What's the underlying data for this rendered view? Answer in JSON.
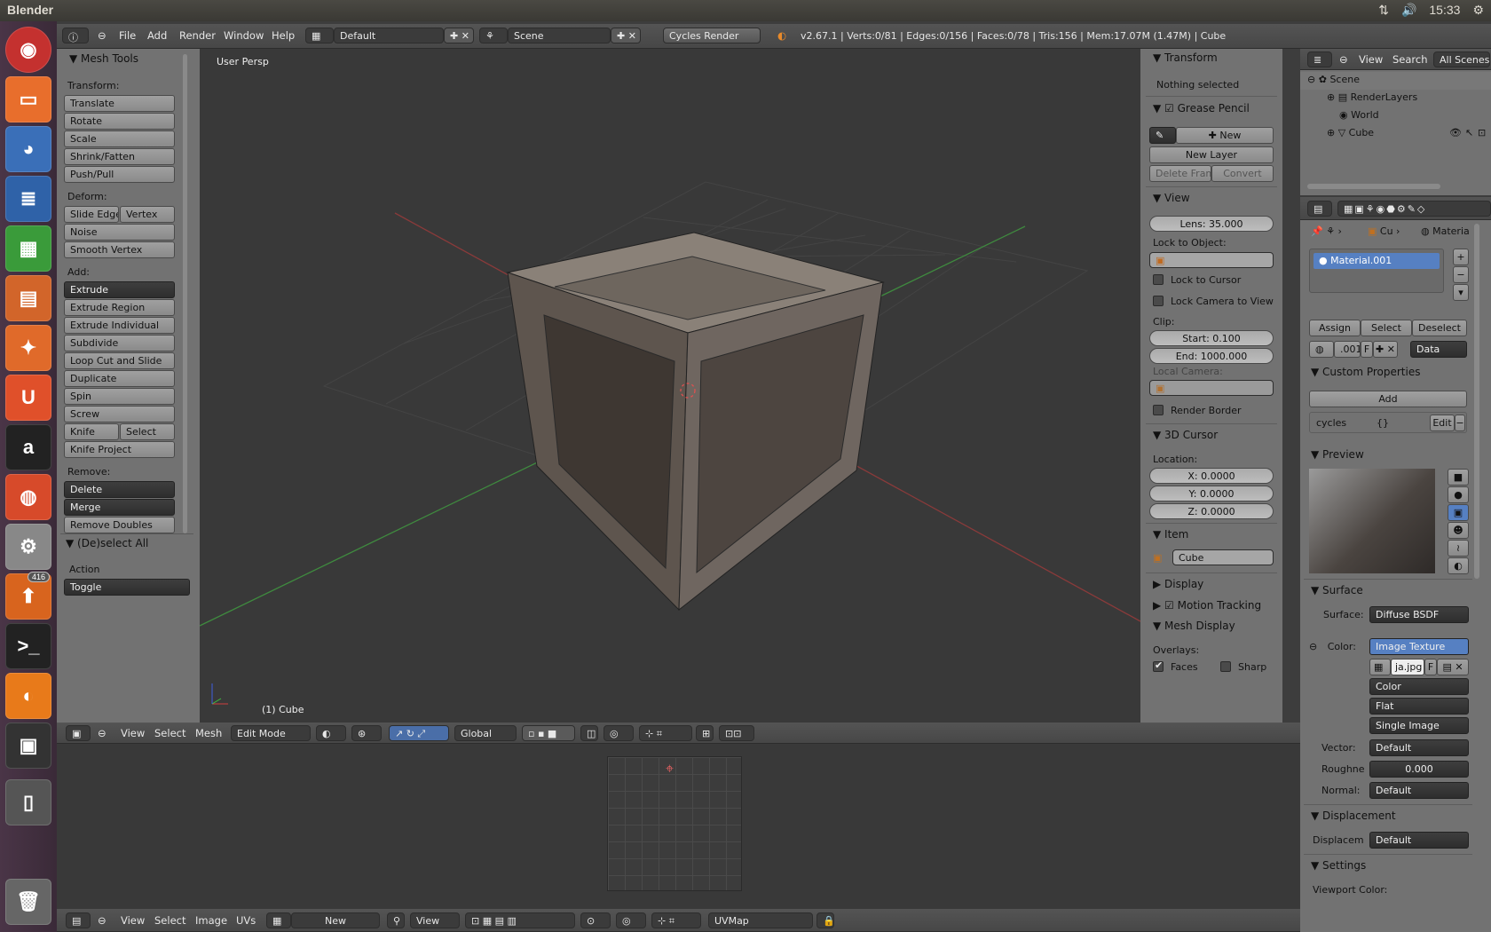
{
  "system": {
    "app_title": "Blender",
    "time": "15:33",
    "launcher_badge": "416"
  },
  "info_header": {
    "menus": [
      "File",
      "Add",
      "Render",
      "Window",
      "Help"
    ],
    "screen_layout": "Default",
    "scene": "Scene",
    "engine": "Cycles Render",
    "stats": "v2.67.1 | Verts:0/81 | Edges:0/156 | Faces:0/78 | Tris:156 | Mem:17.07M (1.47M) | Cube"
  },
  "toolshelf": {
    "title": "Mesh Tools",
    "transform_label": "Transform:",
    "transform": [
      "Translate",
      "Rotate",
      "Scale",
      "Shrink/Fatten",
      "Push/Pull"
    ],
    "deform_label": "Deform:",
    "deform_a": "Slide Edge",
    "deform_b": "Vertex",
    "deform": [
      "Noise",
      "Smooth Vertex"
    ],
    "add_label": "Add:",
    "extrude": "Extrude",
    "add": [
      "Extrude Region",
      "Extrude Individual",
      "Subdivide",
      "Loop Cut and Slide",
      "Duplicate",
      "Spin",
      "Screw"
    ],
    "knife": "Knife",
    "knife_select": "Select",
    "knife_project": "Knife Project",
    "remove_label": "Remove:",
    "delete": "Delete",
    "merge": "Merge",
    "remove_doubles": "Remove Doubles",
    "op_title": "(De)select All",
    "action_label": "Action",
    "action_value": "Toggle"
  },
  "viewport": {
    "view_name": "User Persp",
    "object_name": "(1) Cube",
    "menus": [
      "View",
      "Select",
      "Mesh"
    ],
    "mode": "Edit Mode",
    "orientation": "Global"
  },
  "nprops": {
    "transform_title": "Transform",
    "nothing_selected": "Nothing selected",
    "grease_title": "Grease Pencil",
    "gp_new": "New",
    "gp_new_layer": "New Layer",
    "gp_delete_frame": "Delete Frame",
    "gp_convert": "Convert",
    "view_title": "View",
    "lens": "Lens: 35.000",
    "lock_object_label": "Lock to Object:",
    "lock_cursor": "Lock to Cursor",
    "lock_camera": "Lock Camera to View",
    "clip_label": "Clip:",
    "clip_start": "Start: 0.100",
    "clip_end": "End: 1000.000",
    "local_camera": "Local Camera:",
    "render_border": "Render Border",
    "cursor_title": "3D Cursor",
    "location_label": "Location:",
    "cx": "X: 0.0000",
    "cy": "Y: 0.0000",
    "cz": "Z: 0.0000",
    "item_title": "Item",
    "item_name": "Cube",
    "display_title": "Display",
    "motion_title": "Motion Tracking",
    "mesh_display_title": "Mesh Display",
    "overlays_label": "Overlays:",
    "faces": "Faces",
    "sharp": "Sharp"
  },
  "outliner": {
    "menus": [
      "View",
      "Search"
    ],
    "filter": "All Scenes",
    "items": [
      "Scene",
      "RenderLayers",
      "World",
      "Cube"
    ]
  },
  "properties": {
    "breadcrumb_obj": "Cu",
    "breadcrumb_mat": "Materia",
    "material_slot": "Material.001",
    "assign": "Assign",
    "select": "Select",
    "deselect": "Deselect",
    "mat_id": ".001",
    "mat_f": "F",
    "data_link": "Data",
    "custom_title": "Custom Properties",
    "add": "Add",
    "cycles_key": "cycles",
    "cycles_val": "{}",
    "edit": "Edit",
    "preview_title": "Preview",
    "surface_title": "Surface",
    "surface_label": "Surface:",
    "surface_value": "Diffuse BSDF",
    "color_label": "Color:",
    "color_value": "Image Texture",
    "image_name": "ja.jpg",
    "image_f": "F",
    "opt_color": "Color",
    "opt_flat": "Flat",
    "opt_single": "Single Image",
    "vector_label": "Vector:",
    "vector_value": "Default",
    "rough_label": "Roughne",
    "rough_value": "0.000",
    "normal_label": "Normal:",
    "normal_value": "Default",
    "displacement_title": "Displacement",
    "displace_label": "Displacem",
    "displace_value": "Default",
    "settings_title": "Settings",
    "viewport_color": "Viewport Color:"
  },
  "uv_editor": {
    "menus": [
      "View",
      "Select",
      "Image",
      "UVs"
    ],
    "new": "New",
    "view": "View",
    "uvmap": "UVMap"
  }
}
